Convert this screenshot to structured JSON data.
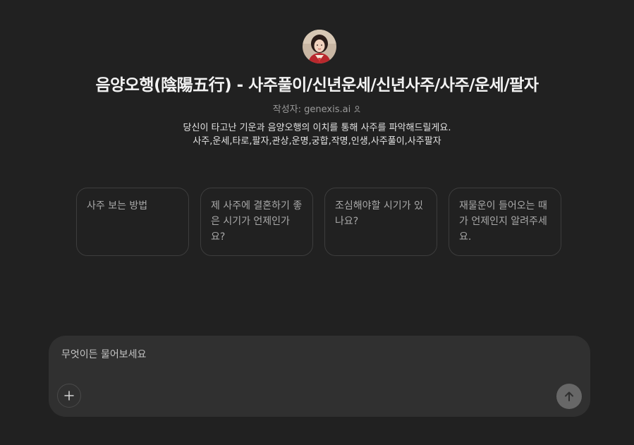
{
  "gpt": {
    "avatar_icon": "avatar-portrait",
    "title": "음양오행(陰陽五行) - 사주풀이/신년운세/신년사주/사주/운세/팔자",
    "author_prefix": "작성자: ",
    "author_name": "genexis.ai",
    "description_line1": "당신이 타고난 기운과 음양오행의 이치를 통해 사주를 파악해드릴게요.",
    "description_line2": "사주,운세,타로,팔자,관상,운명,궁합,작명,인생,사주풀이,사주팔자"
  },
  "starters": [
    "사주 보는 방법",
    "제 사주에 결혼하기 좋은 시기가 언제인가요?",
    "조심해야할 시기가 있나요?",
    "재물운이 들어오는 때가 언제인지 알려주세요."
  ],
  "composer": {
    "placeholder": "무엇이든 물어보세요",
    "value": "",
    "plus_icon": "plus-icon",
    "send_icon": "arrow-up-icon"
  },
  "colors": {
    "background": "#212121",
    "composer_bg": "#303030",
    "send_button_bg": "#676767"
  }
}
